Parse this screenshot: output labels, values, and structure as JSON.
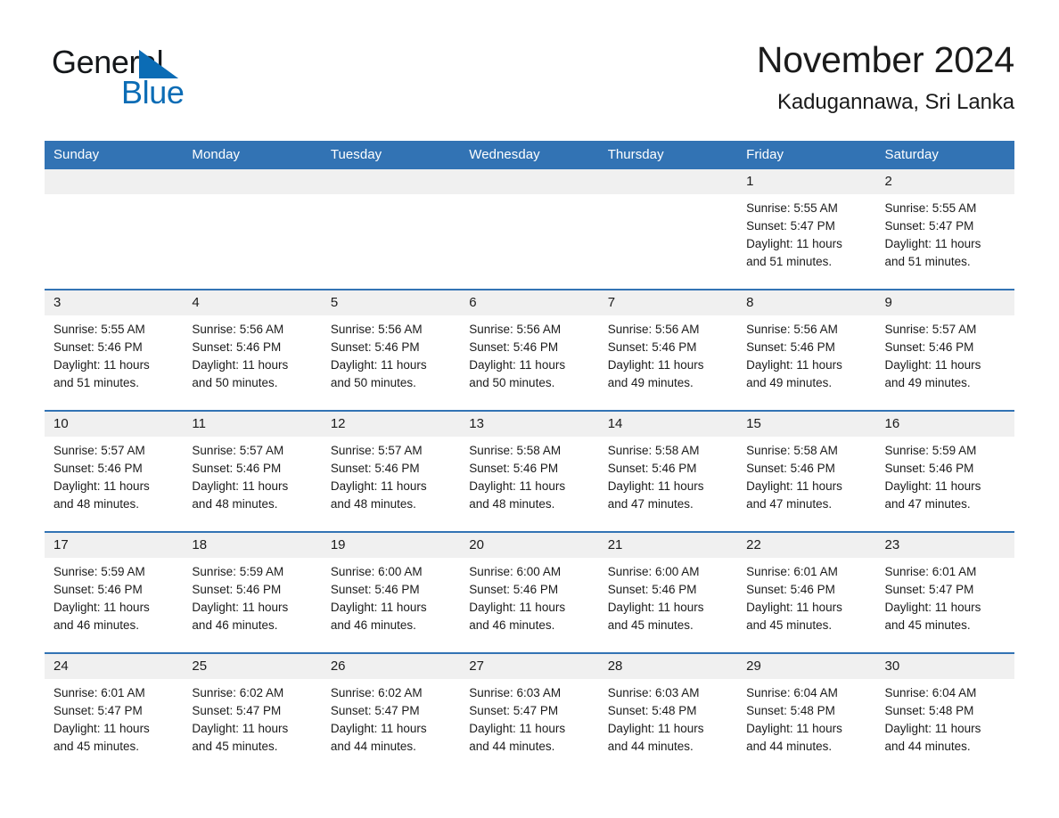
{
  "brand": {
    "word_one": "General",
    "word_two": "Blue",
    "triangle_icon": "blue-triangle-icon",
    "accent_color": "#0b6cb5"
  },
  "header": {
    "title": "November 2024",
    "subtitle": "Kadugannawa, Sri Lanka"
  },
  "colors": {
    "header_blue": "#3273b4",
    "daynum_gray": "#f0f0f0",
    "text": "#1b1b1b"
  },
  "labels": {
    "sunrise_prefix": "Sunrise:",
    "sunset_prefix": "Sunset:",
    "daylight_prefix": "Daylight:"
  },
  "weekday_headers": [
    "Sunday",
    "Monday",
    "Tuesday",
    "Wednesday",
    "Thursday",
    "Friday",
    "Saturday"
  ],
  "weeks": [
    [
      {
        "day": "",
        "sunrise": "",
        "sunset": "",
        "daylight_line1": "",
        "daylight_line2": ""
      },
      {
        "day": "",
        "sunrise": "",
        "sunset": "",
        "daylight_line1": "",
        "daylight_line2": ""
      },
      {
        "day": "",
        "sunrise": "",
        "sunset": "",
        "daylight_line1": "",
        "daylight_line2": ""
      },
      {
        "day": "",
        "sunrise": "",
        "sunset": "",
        "daylight_line1": "",
        "daylight_line2": ""
      },
      {
        "day": "",
        "sunrise": "",
        "sunset": "",
        "daylight_line1": "",
        "daylight_line2": ""
      },
      {
        "day": "1",
        "sunrise": "Sunrise: 5:55 AM",
        "sunset": "Sunset: 5:47 PM",
        "daylight_line1": "Daylight: 11 hours",
        "daylight_line2": "and 51 minutes."
      },
      {
        "day": "2",
        "sunrise": "Sunrise: 5:55 AM",
        "sunset": "Sunset: 5:47 PM",
        "daylight_line1": "Daylight: 11 hours",
        "daylight_line2": "and 51 minutes."
      }
    ],
    [
      {
        "day": "3",
        "sunrise": "Sunrise: 5:55 AM",
        "sunset": "Sunset: 5:46 PM",
        "daylight_line1": "Daylight: 11 hours",
        "daylight_line2": "and 51 minutes."
      },
      {
        "day": "4",
        "sunrise": "Sunrise: 5:56 AM",
        "sunset": "Sunset: 5:46 PM",
        "daylight_line1": "Daylight: 11 hours",
        "daylight_line2": "and 50 minutes."
      },
      {
        "day": "5",
        "sunrise": "Sunrise: 5:56 AM",
        "sunset": "Sunset: 5:46 PM",
        "daylight_line1": "Daylight: 11 hours",
        "daylight_line2": "and 50 minutes."
      },
      {
        "day": "6",
        "sunrise": "Sunrise: 5:56 AM",
        "sunset": "Sunset: 5:46 PM",
        "daylight_line1": "Daylight: 11 hours",
        "daylight_line2": "and 50 minutes."
      },
      {
        "day": "7",
        "sunrise": "Sunrise: 5:56 AM",
        "sunset": "Sunset: 5:46 PM",
        "daylight_line1": "Daylight: 11 hours",
        "daylight_line2": "and 49 minutes."
      },
      {
        "day": "8",
        "sunrise": "Sunrise: 5:56 AM",
        "sunset": "Sunset: 5:46 PM",
        "daylight_line1": "Daylight: 11 hours",
        "daylight_line2": "and 49 minutes."
      },
      {
        "day": "9",
        "sunrise": "Sunrise: 5:57 AM",
        "sunset": "Sunset: 5:46 PM",
        "daylight_line1": "Daylight: 11 hours",
        "daylight_line2": "and 49 minutes."
      }
    ],
    [
      {
        "day": "10",
        "sunrise": "Sunrise: 5:57 AM",
        "sunset": "Sunset: 5:46 PM",
        "daylight_line1": "Daylight: 11 hours",
        "daylight_line2": "and 48 minutes."
      },
      {
        "day": "11",
        "sunrise": "Sunrise: 5:57 AM",
        "sunset": "Sunset: 5:46 PM",
        "daylight_line1": "Daylight: 11 hours",
        "daylight_line2": "and 48 minutes."
      },
      {
        "day": "12",
        "sunrise": "Sunrise: 5:57 AM",
        "sunset": "Sunset: 5:46 PM",
        "daylight_line1": "Daylight: 11 hours",
        "daylight_line2": "and 48 minutes."
      },
      {
        "day": "13",
        "sunrise": "Sunrise: 5:58 AM",
        "sunset": "Sunset: 5:46 PM",
        "daylight_line1": "Daylight: 11 hours",
        "daylight_line2": "and 48 minutes."
      },
      {
        "day": "14",
        "sunrise": "Sunrise: 5:58 AM",
        "sunset": "Sunset: 5:46 PM",
        "daylight_line1": "Daylight: 11 hours",
        "daylight_line2": "and 47 minutes."
      },
      {
        "day": "15",
        "sunrise": "Sunrise: 5:58 AM",
        "sunset": "Sunset: 5:46 PM",
        "daylight_line1": "Daylight: 11 hours",
        "daylight_line2": "and 47 minutes."
      },
      {
        "day": "16",
        "sunrise": "Sunrise: 5:59 AM",
        "sunset": "Sunset: 5:46 PM",
        "daylight_line1": "Daylight: 11 hours",
        "daylight_line2": "and 47 minutes."
      }
    ],
    [
      {
        "day": "17",
        "sunrise": "Sunrise: 5:59 AM",
        "sunset": "Sunset: 5:46 PM",
        "daylight_line1": "Daylight: 11 hours",
        "daylight_line2": "and 46 minutes."
      },
      {
        "day": "18",
        "sunrise": "Sunrise: 5:59 AM",
        "sunset": "Sunset: 5:46 PM",
        "daylight_line1": "Daylight: 11 hours",
        "daylight_line2": "and 46 minutes."
      },
      {
        "day": "19",
        "sunrise": "Sunrise: 6:00 AM",
        "sunset": "Sunset: 5:46 PM",
        "daylight_line1": "Daylight: 11 hours",
        "daylight_line2": "and 46 minutes."
      },
      {
        "day": "20",
        "sunrise": "Sunrise: 6:00 AM",
        "sunset": "Sunset: 5:46 PM",
        "daylight_line1": "Daylight: 11 hours",
        "daylight_line2": "and 46 minutes."
      },
      {
        "day": "21",
        "sunrise": "Sunrise: 6:00 AM",
        "sunset": "Sunset: 5:46 PM",
        "daylight_line1": "Daylight: 11 hours",
        "daylight_line2": "and 45 minutes."
      },
      {
        "day": "22",
        "sunrise": "Sunrise: 6:01 AM",
        "sunset": "Sunset: 5:46 PM",
        "daylight_line1": "Daylight: 11 hours",
        "daylight_line2": "and 45 minutes."
      },
      {
        "day": "23",
        "sunrise": "Sunrise: 6:01 AM",
        "sunset": "Sunset: 5:47 PM",
        "daylight_line1": "Daylight: 11 hours",
        "daylight_line2": "and 45 minutes."
      }
    ],
    [
      {
        "day": "24",
        "sunrise": "Sunrise: 6:01 AM",
        "sunset": "Sunset: 5:47 PM",
        "daylight_line1": "Daylight: 11 hours",
        "daylight_line2": "and 45 minutes."
      },
      {
        "day": "25",
        "sunrise": "Sunrise: 6:02 AM",
        "sunset": "Sunset: 5:47 PM",
        "daylight_line1": "Daylight: 11 hours",
        "daylight_line2": "and 45 minutes."
      },
      {
        "day": "26",
        "sunrise": "Sunrise: 6:02 AM",
        "sunset": "Sunset: 5:47 PM",
        "daylight_line1": "Daylight: 11 hours",
        "daylight_line2": "and 44 minutes."
      },
      {
        "day": "27",
        "sunrise": "Sunrise: 6:03 AM",
        "sunset": "Sunset: 5:47 PM",
        "daylight_line1": "Daylight: 11 hours",
        "daylight_line2": "and 44 minutes."
      },
      {
        "day": "28",
        "sunrise": "Sunrise: 6:03 AM",
        "sunset": "Sunset: 5:48 PM",
        "daylight_line1": "Daylight: 11 hours",
        "daylight_line2": "and 44 minutes."
      },
      {
        "day": "29",
        "sunrise": "Sunrise: 6:04 AM",
        "sunset": "Sunset: 5:48 PM",
        "daylight_line1": "Daylight: 11 hours",
        "daylight_line2": "and 44 minutes."
      },
      {
        "day": "30",
        "sunrise": "Sunrise: 6:04 AM",
        "sunset": "Sunset: 5:48 PM",
        "daylight_line1": "Daylight: 11 hours",
        "daylight_line2": "and 44 minutes."
      }
    ]
  ]
}
